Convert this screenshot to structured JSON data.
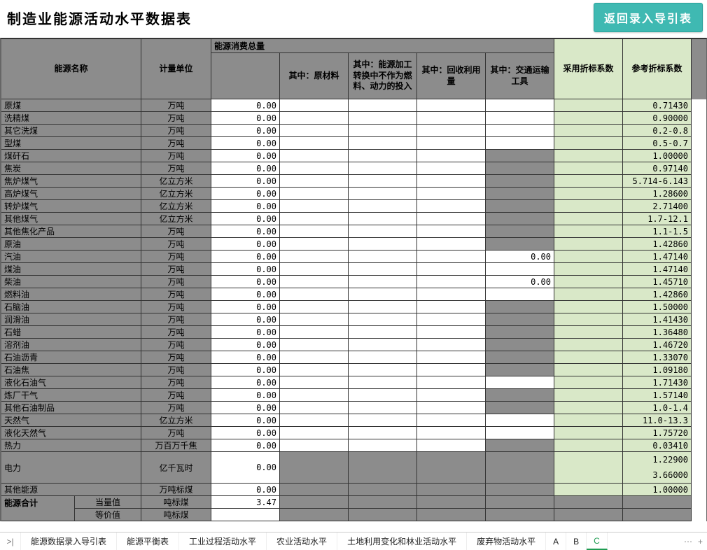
{
  "title": "制造业能源活动水平数据表",
  "buttons": {
    "back": "返回录入导引表"
  },
  "headers": {
    "name": "能源名称",
    "unit": "计量单位",
    "consume_group": "能源消费总量",
    "sub_blank": "",
    "sub_raw": "其中：原材料",
    "sub_proc": "其中：能源加工转换中不作为燃料、动力的投入",
    "sub_recyc": "其中：回收利用量",
    "sub_trans": "其中：交通运输工具",
    "coef_used": "采用折标系数",
    "coef_ref": "参考折标系数"
  },
  "units": {
    "wd": "万吨",
    "ylfm": "亿立方米",
    "wbwqj": "万百万千焦",
    "yqws": "亿千瓦时",
    "wdbm": "万吨标煤",
    "dbm": "吨标煤"
  },
  "rows": [
    {
      "name": "原煤",
      "unit": "万吨",
      "total": "0.00",
      "raw": "",
      "proc": "",
      "recyc": "",
      "trans": "",
      "trans_gr": false,
      "coef": "0.71430"
    },
    {
      "name": "洗精煤",
      "unit": "万吨",
      "total": "0.00",
      "raw": "",
      "proc": "",
      "recyc": "",
      "trans": "",
      "trans_gr": false,
      "coef": "0.90000"
    },
    {
      "name": "其它洗煤",
      "unit": "万吨",
      "total": "0.00",
      "raw": "",
      "proc": "",
      "recyc": "",
      "trans": "",
      "trans_gr": false,
      "coef": "0.2-0.8"
    },
    {
      "name": "型煤",
      "unit": "万吨",
      "total": "0.00",
      "raw": "",
      "proc": "",
      "recyc": "",
      "trans": "",
      "trans_gr": false,
      "coef": "0.5-0.7"
    },
    {
      "name": "煤矸石",
      "unit": "万吨",
      "total": "0.00",
      "raw": "",
      "proc": "",
      "recyc": "",
      "trans": "",
      "trans_gr": true,
      "coef": "1.00000"
    },
    {
      "name": "焦炭",
      "unit": "万吨",
      "total": "0.00",
      "raw": "",
      "proc": "",
      "recyc": "",
      "trans": "",
      "trans_gr": true,
      "coef": "0.97140"
    },
    {
      "name": "焦炉煤气",
      "unit": "亿立方米",
      "total": "0.00",
      "raw": "",
      "proc": "",
      "recyc": "",
      "trans": "",
      "trans_gr": true,
      "coef": "5.714-6.143"
    },
    {
      "name": "高炉煤气",
      "unit": "亿立方米",
      "total": "0.00",
      "raw": "",
      "proc": "",
      "recyc": "",
      "trans": "",
      "trans_gr": true,
      "coef": "1.28600"
    },
    {
      "name": "转炉煤气",
      "unit": "亿立方米",
      "total": "0.00",
      "raw": "",
      "proc": "",
      "recyc": "",
      "trans": "",
      "trans_gr": true,
      "coef": "2.71400"
    },
    {
      "name": "其他煤气",
      "unit": "亿立方米",
      "total": "0.00",
      "raw": "",
      "proc": "",
      "recyc": "",
      "trans": "",
      "trans_gr": true,
      "coef": "1.7-12.1"
    },
    {
      "name": "其他焦化产品",
      "unit": "万吨",
      "total": "0.00",
      "raw": "",
      "proc": "",
      "recyc": "",
      "trans": "",
      "trans_gr": true,
      "coef": "1.1-1.5"
    },
    {
      "name": "原油",
      "unit": "万吨",
      "total": "0.00",
      "raw": "",
      "proc": "",
      "recyc": "",
      "trans": "",
      "trans_gr": true,
      "coef": "1.42860"
    },
    {
      "name": "汽油",
      "unit": "万吨",
      "total": "0.00",
      "raw": "",
      "proc": "",
      "recyc": "",
      "trans": "0.00",
      "trans_gr": false,
      "coef": "1.47140"
    },
    {
      "name": "煤油",
      "unit": "万吨",
      "total": "0.00",
      "raw": "",
      "proc": "",
      "recyc": "",
      "trans": "",
      "trans_gr": false,
      "coef": "1.47140"
    },
    {
      "name": "柴油",
      "unit": "万吨",
      "total": "0.00",
      "raw": "",
      "proc": "",
      "recyc": "",
      "trans": "0.00",
      "trans_gr": false,
      "coef": "1.45710"
    },
    {
      "name": "燃料油",
      "unit": "万吨",
      "total": "0.00",
      "raw": "",
      "proc": "",
      "recyc": "",
      "trans": "",
      "trans_gr": false,
      "coef": "1.42860"
    },
    {
      "name": "石脑油",
      "unit": "万吨",
      "total": "0.00",
      "raw": "",
      "proc": "",
      "recyc": "",
      "trans": "",
      "trans_gr": true,
      "coef": "1.50000"
    },
    {
      "name": "润滑油",
      "unit": "万吨",
      "total": "0.00",
      "raw": "",
      "proc": "",
      "recyc": "",
      "trans": "",
      "trans_gr": true,
      "coef": "1.41430"
    },
    {
      "name": "石蜡",
      "unit": "万吨",
      "total": "0.00",
      "raw": "",
      "proc": "",
      "recyc": "",
      "trans": "",
      "trans_gr": true,
      "coef": "1.36480"
    },
    {
      "name": "溶剂油",
      "unit": "万吨",
      "total": "0.00",
      "raw": "",
      "proc": "",
      "recyc": "",
      "trans": "",
      "trans_gr": true,
      "coef": "1.46720"
    },
    {
      "name": "石油沥青",
      "unit": "万吨",
      "total": "0.00",
      "raw": "",
      "proc": "",
      "recyc": "",
      "trans": "",
      "trans_gr": true,
      "coef": "1.33070"
    },
    {
      "name": "石油焦",
      "unit": "万吨",
      "total": "0.00",
      "raw": "",
      "proc": "",
      "recyc": "",
      "trans": "",
      "trans_gr": true,
      "coef": "1.09180"
    },
    {
      "name": "液化石油气",
      "unit": "万吨",
      "total": "0.00",
      "raw": "",
      "proc": "",
      "recyc": "",
      "trans": "",
      "trans_gr": false,
      "coef": "1.71430"
    },
    {
      "name": "炼厂干气",
      "unit": "万吨",
      "total": "0.00",
      "raw": "",
      "proc": "",
      "recyc": "",
      "trans": "",
      "trans_gr": true,
      "coef": "1.57140"
    },
    {
      "name": "其他石油制品",
      "unit": "万吨",
      "total": "0.00",
      "raw": "",
      "proc": "",
      "recyc": "",
      "trans": "",
      "trans_gr": true,
      "coef": "1.0-1.4"
    },
    {
      "name": "天然气",
      "unit": "亿立方米",
      "total": "0.00",
      "raw": "",
      "proc": "",
      "recyc": "",
      "trans": "",
      "trans_gr": false,
      "coef": "11.0-13.3"
    },
    {
      "name": "液化天然气",
      "unit": "万吨",
      "total": "0.00",
      "raw": "",
      "proc": "",
      "recyc": "",
      "trans": "",
      "trans_gr": false,
      "coef": "1.75720"
    },
    {
      "name": "热力",
      "unit": "万百万千焦",
      "total": "0.00",
      "raw": "",
      "proc": "",
      "recyc": "",
      "trans": "",
      "trans_gr": true,
      "coef": "0.03410"
    }
  ],
  "elec": {
    "name": "电力",
    "unit": "亿千瓦时",
    "total": "0.00",
    "coef1": "1.22900",
    "coef2": "3.66000"
  },
  "other_energy": {
    "name": "其他能源",
    "unit": "万吨标煤",
    "total": "0.00",
    "coef": "1.00000"
  },
  "energy_total": {
    "label": "能源合计",
    "row1": {
      "sub": "当量值",
      "unit": "吨标煤",
      "total": "3.47"
    },
    "row2": {
      "sub": "等价值",
      "unit": "吨标煤",
      "total": ""
    }
  },
  "tabs": {
    "list": [
      "能源数据录入导引表",
      "能源平衡表",
      "工业过程活动水平",
      "农业活动水平",
      "土地利用变化和林业活动水平",
      "废弃物活动水平",
      "A",
      "B",
      "C"
    ],
    "active": 8
  }
}
